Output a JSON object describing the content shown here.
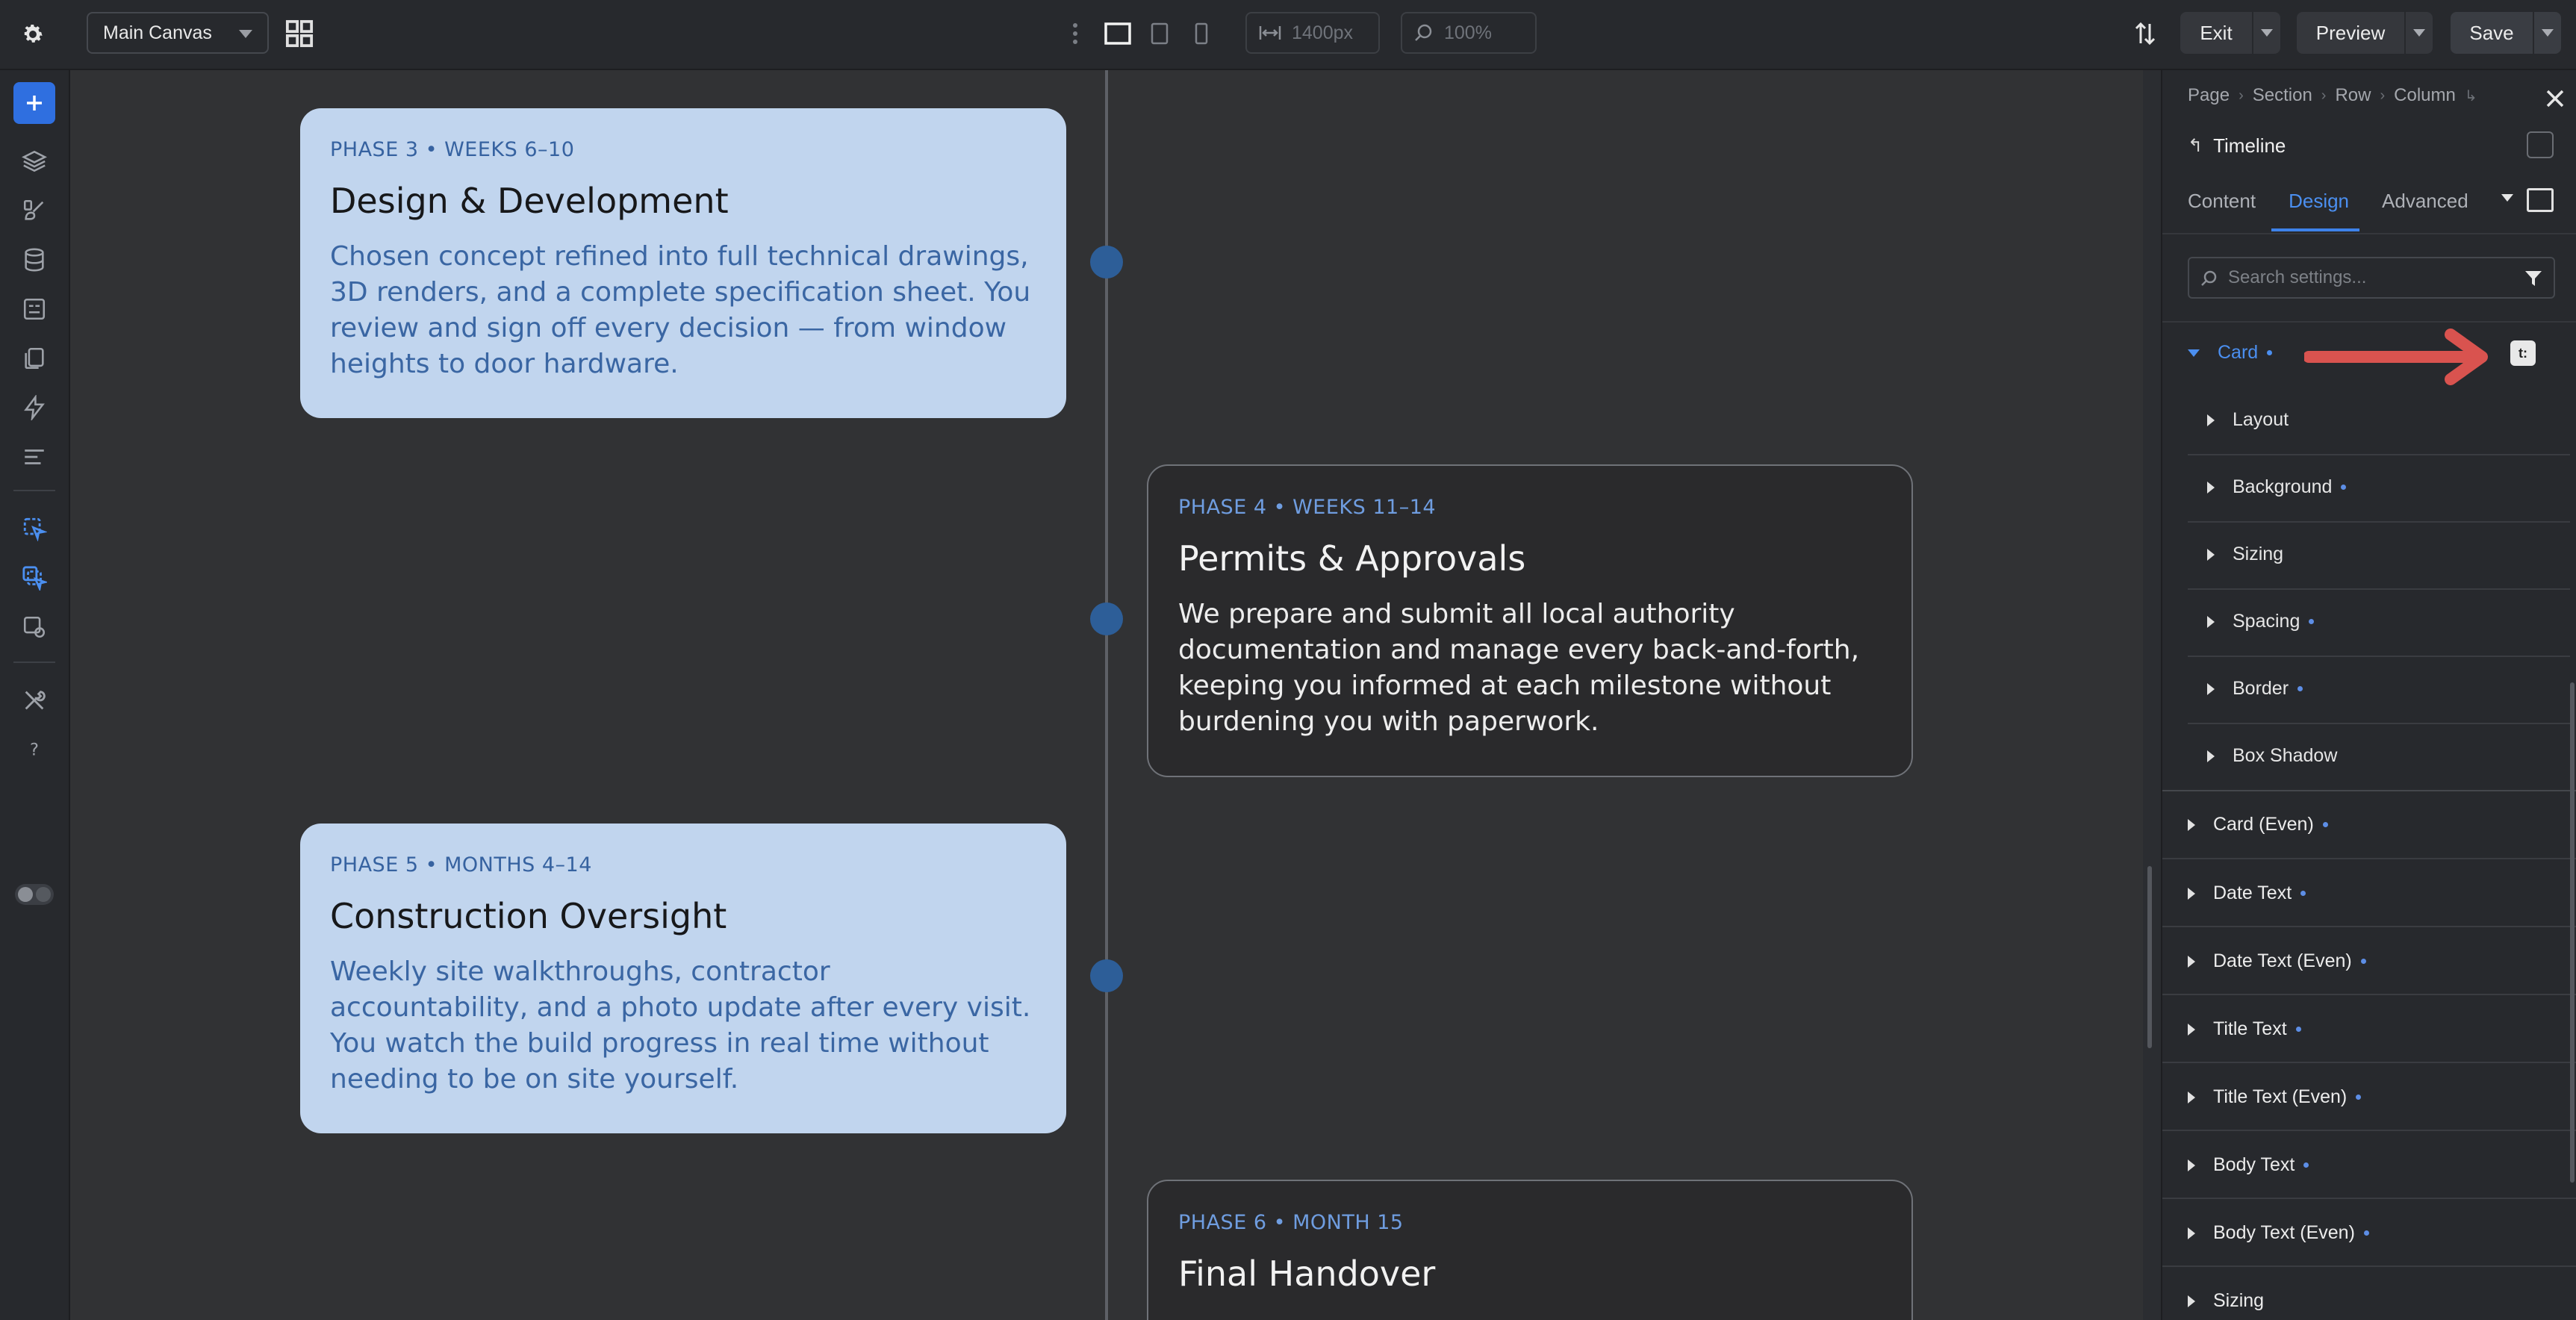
{
  "topbar": {
    "canvas_select": "Main Canvas",
    "width_value": "1400px",
    "zoom_value": "100%",
    "exit_label": "Exit",
    "preview_label": "Preview",
    "save_label": "Save"
  },
  "canvas": {
    "cards": [
      {
        "date": "PHASE 3 • WEEKS 6–10",
        "title": "Design & Development",
        "body": "Chosen concept refined into full technical drawings, 3D renders, and a complete specification sheet. You review and sign off every decision — from window heights to door hardware."
      },
      {
        "date": "PHASE 4 • WEEKS 11–14",
        "title": "Permits & Approvals",
        "body": "We prepare and submit all local authority documentation and manage every back-and-forth, keeping you informed at each milestone without burdening you with paperwork."
      },
      {
        "date": "PHASE 5 • MONTHS 4–14",
        "title": "Construction Oversight",
        "body": "Weekly site walkthroughs, contractor accountability, and a photo update after every visit. You watch the build progress in real time without needing to be on site yourself."
      },
      {
        "date": "PHASE 6 • MONTH 15",
        "title": "Final Handover",
        "body": ""
      }
    ]
  },
  "panel": {
    "breadcrumb": [
      "Page",
      "Section",
      "Row",
      "Column"
    ],
    "element_title": "Timeline",
    "tabs": [
      "Content",
      "Design",
      "Advanced"
    ],
    "search_placeholder": "Search settings...",
    "open_group": "Card",
    "reset_label": "t:",
    "sub_groups": [
      "Layout",
      "Background",
      "Sizing",
      "Spacing",
      "Border",
      "Box Shadow"
    ],
    "groups": [
      "Card (Even)",
      "Date Text",
      "Date Text (Even)",
      "Title Text",
      "Title Text (Even)",
      "Body Text",
      "Body Text (Even)",
      "Sizing"
    ]
  },
  "colors": {
    "accent": "#3e82ea",
    "odd_card_bg": "#c1d5ee",
    "even_card_bg": "#2a2a2c",
    "timeline_dot": "#2d5e98",
    "annotation_arrow": "#d9534f"
  },
  "icons": [
    "gear-icon",
    "grid-icon",
    "kebab-icon",
    "desktop-icon",
    "tablet-icon",
    "mobile-icon",
    "width-icon",
    "zoom-icon",
    "sort-icon",
    "plus-icon",
    "layers-icon",
    "brush-icon",
    "database-icon",
    "template-icon",
    "pages-icon",
    "bolt-icon",
    "list-icon",
    "cursor-icon",
    "cursor-multi-icon",
    "settings-image-icon",
    "tools-icon",
    "help-icon",
    "close-icon",
    "filter-icon",
    "search-icon"
  ]
}
